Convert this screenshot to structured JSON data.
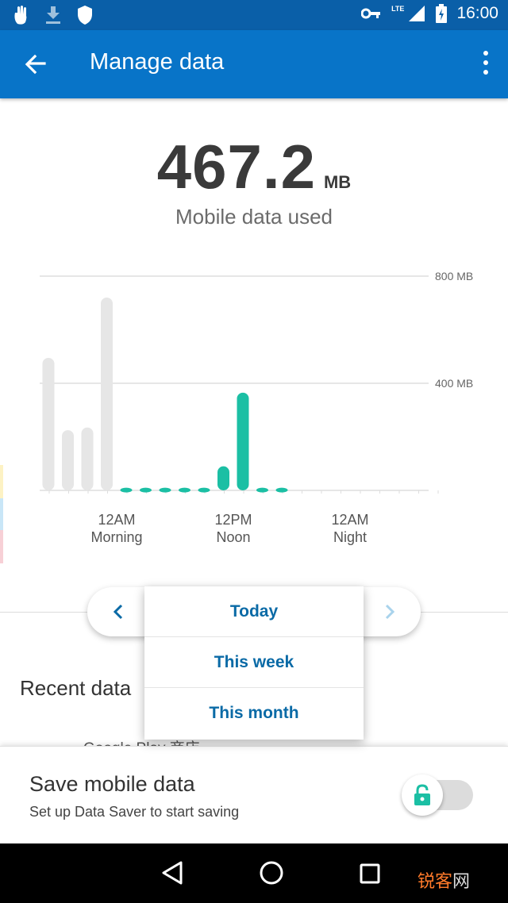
{
  "status_bar": {
    "time": "16:00",
    "network_label": "LTE",
    "icons": [
      "hand-icon",
      "download-icon",
      "shield-icon",
      "key-icon",
      "signal-icon",
      "battery-icon"
    ]
  },
  "app_bar": {
    "title": "Manage data",
    "icons": [
      "back-arrow-icon",
      "more-vert-icon"
    ]
  },
  "usage": {
    "value": "467.2",
    "unit": "MB",
    "label": "Mobile data used"
  },
  "chart_data": {
    "type": "bar",
    "y_ticks": [
      "800 MB",
      "400 MB"
    ],
    "ylim": [
      0,
      800
    ],
    "x_tick_labels": [
      {
        "time": "12AM",
        "period": "Morning"
      },
      {
        "time": "12PM",
        "period": "Noon"
      },
      {
        "time": "12AM",
        "period": "Night"
      }
    ],
    "bars": [
      {
        "value": 495,
        "status": "past"
      },
      {
        "value": 225,
        "status": "past"
      },
      {
        "value": 235,
        "status": "past"
      },
      {
        "value": 720,
        "status": "past"
      },
      {
        "value": 10,
        "status": "today"
      },
      {
        "value": 10,
        "status": "today"
      },
      {
        "value": 10,
        "status": "today"
      },
      {
        "value": 10,
        "status": "today"
      },
      {
        "value": 10,
        "status": "today"
      },
      {
        "value": 90,
        "status": "today"
      },
      {
        "value": 365,
        "status": "today"
      },
      {
        "value": 10,
        "status": "today"
      },
      {
        "value": 10,
        "status": "today"
      }
    ],
    "colors": {
      "past": "#e6e6e6",
      "today": "#1bbfa4",
      "grid": "#dedede"
    }
  },
  "pager": {
    "prev_icon": "chevron-left-icon",
    "next_icon": "chevron-right-icon"
  },
  "dropdown": {
    "options": [
      "Today",
      "This week",
      "This month"
    ]
  },
  "recent": {
    "title": "Recent data",
    "partial_row": "Google Play 商店"
  },
  "save_data": {
    "title": "Save mobile data",
    "subtitle": "Set up Data Saver to start saving",
    "toggle_on": false,
    "toggle_icon": "lock-icon"
  },
  "nav_bar": {
    "icons": [
      "nav-back-icon",
      "nav-home-icon",
      "nav-recents-icon"
    ],
    "watermark_a": "锐客",
    "watermark_b": "网"
  },
  "colors": {
    "primary": "#0874c8",
    "status": "#0a5fa8",
    "accent": "#1bbfa4",
    "link": "#0a6aa6"
  }
}
